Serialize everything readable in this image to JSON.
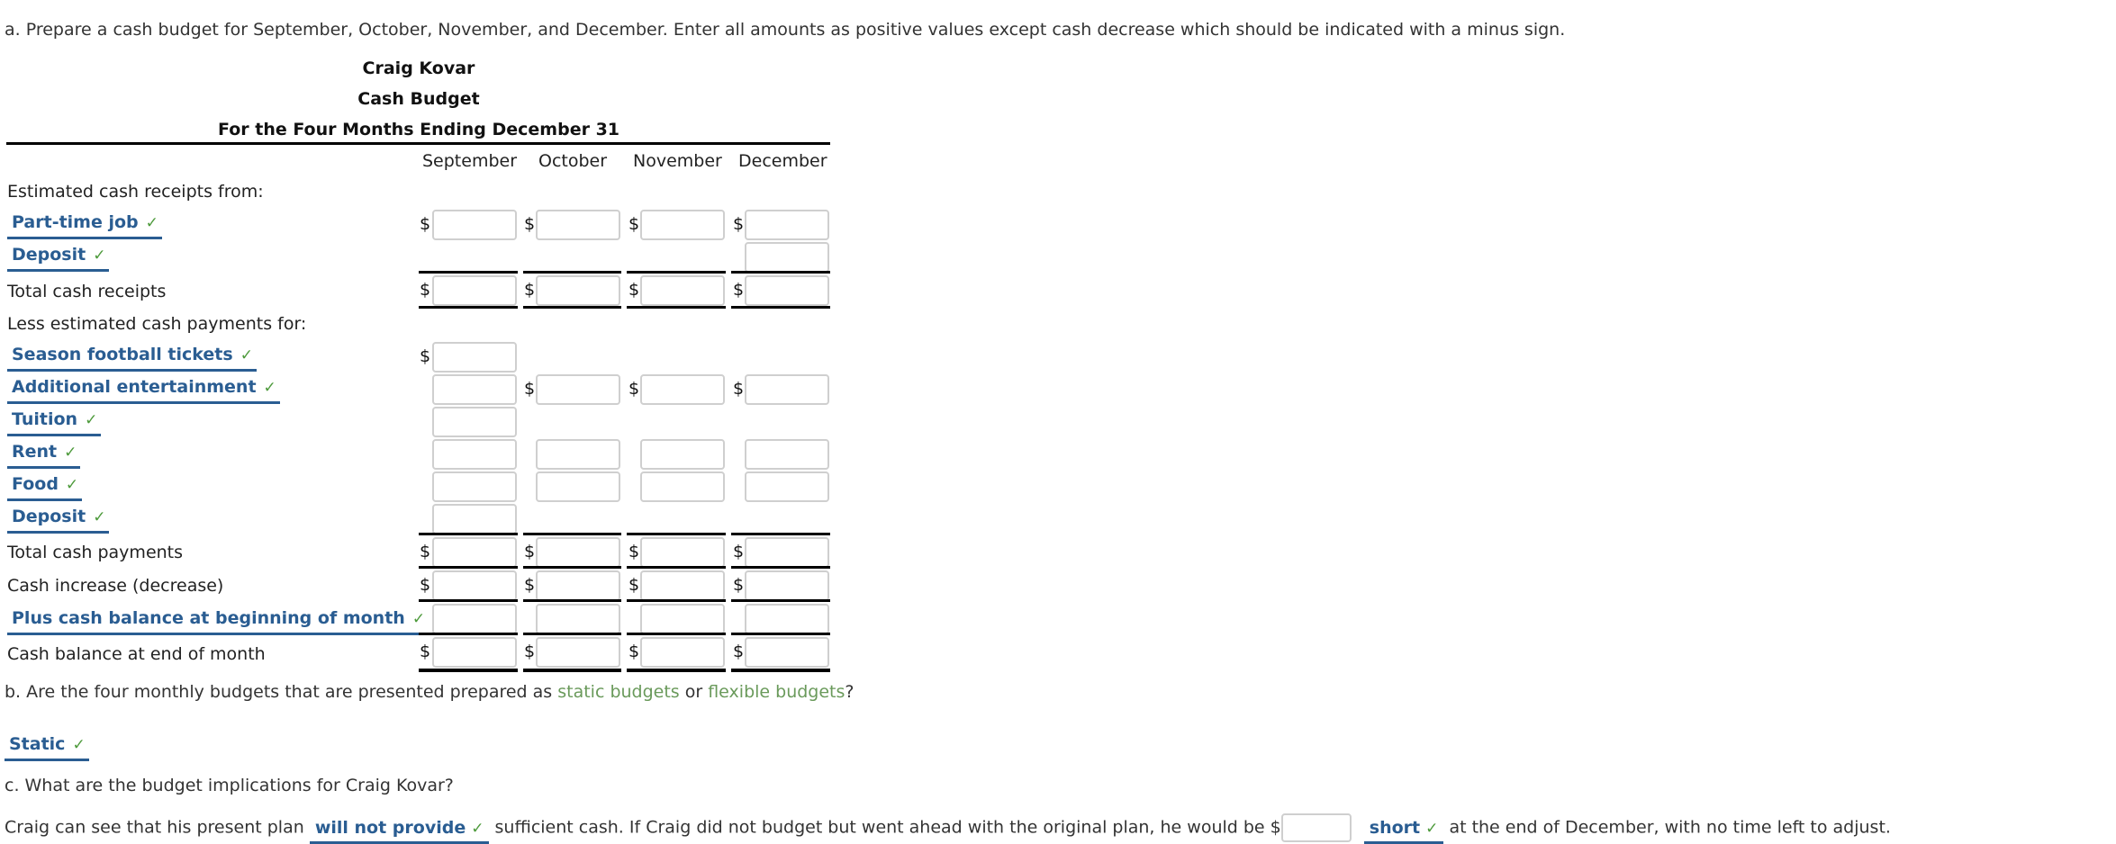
{
  "instructions": {
    "part_a": "a. Prepare a cash budget for September, October, November, and December. Enter all amounts as positive values except cash decrease which should be indicated with a minus sign.",
    "part_b_prefix": "b. Are the four monthly budgets that are presented prepared as ",
    "part_b_term1": "static budgets",
    "part_b_mid": " or ",
    "part_b_term2": "flexible budgets",
    "part_b_suffix": "?",
    "part_c": "c. What are the budget implications for Craig Kovar?"
  },
  "header": {
    "name": "Craig Kovar",
    "title": "Cash Budget",
    "period": "For the Four Months Ending December 31"
  },
  "months": [
    "September",
    "October",
    "November",
    "December"
  ],
  "labels": {
    "receipts_heading": "Estimated cash receipts from:",
    "total_receipts": "Total cash receipts",
    "payments_heading": "Less estimated cash payments for:",
    "total_payments": "Total cash payments",
    "cash_change": "Cash increase (decrease)",
    "end_balance": "Cash balance at end of month"
  },
  "selections": {
    "receipt_1": "Part-time job",
    "receipt_2": "Deposit",
    "payment_1": "Season football tickets",
    "payment_2": "Additional entertainment",
    "payment_3": "Tuition",
    "payment_4": "Rent",
    "payment_5": "Food",
    "payment_6": "Deposit",
    "beginning_balance": "Plus cash balance at beginning of month",
    "budget_type": "Static",
    "plan_outcome": "will not provide",
    "shortfall_type": "short"
  },
  "check_mark": "✓",
  "currency_symbol": "$",
  "sentence_c": {
    "part1": "Craig can see that his present plan ",
    "part2": " sufficient cash. If Craig did not budget but went ahead with the original plan, he would be $",
    "part3": " at the end of December, with no time left to adjust."
  },
  "inputs": {
    "shortfall_amount": ""
  },
  "colors": {
    "selection_blue": "#2a5d92",
    "check_green": "#4d9a3b",
    "term_green": "#6a9a5b"
  }
}
